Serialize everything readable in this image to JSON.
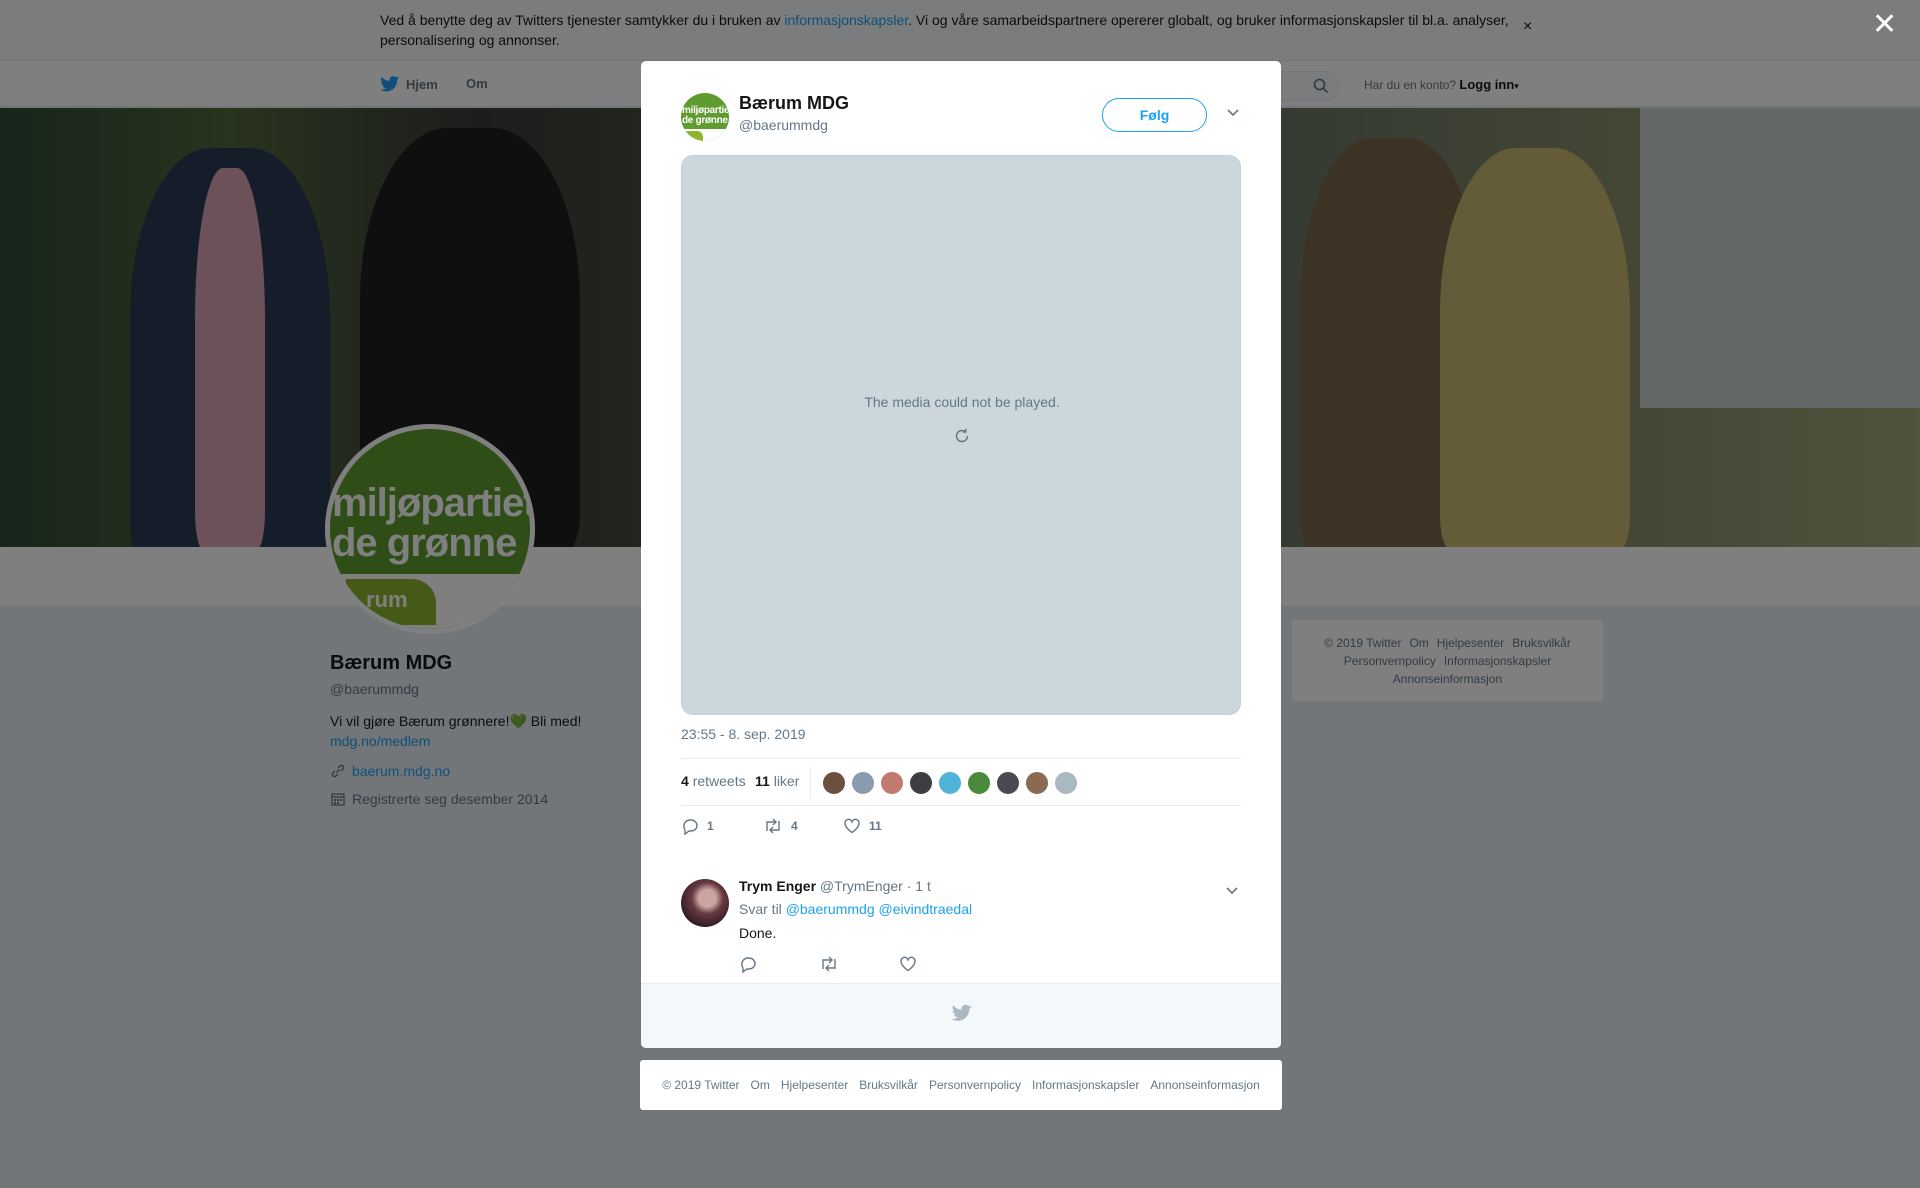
{
  "cookie": {
    "text_before": "Ved å benytte deg av Twitters tjenester samtykker du i bruken av ",
    "link": "informasjonskapsler",
    "text_after": ". Vi og våre samarbeidspartnere opererer globalt, og bruker informasjonskapsler til bl.a. analyser, personalisering og annonser.",
    "close_glyph": "×"
  },
  "nav": {
    "home": "Hjem",
    "about": "Om",
    "account_prompt": "Har du en konto?",
    "login": "Logg inn"
  },
  "profile": {
    "avatar_line1": "miljøpartiet",
    "avatar_line2": "de grønne",
    "avatar_badge": "rum",
    "name": "Bærum MDG",
    "handle": "@baerummdg",
    "bio_text": "Vi vil gjøre Bærum grønnere!",
    "bio_heart": "💚",
    "bio_after": " Bli med!",
    "bio_link": "mdg.no/medlem",
    "url": "baerum.mdg.no",
    "joined": "Registrerte seg desember 2014"
  },
  "side_footer": {
    "row1": [
      "© 2019 Twitter",
      "Om",
      "Hjelpesenter",
      "Bruksvilkår"
    ],
    "row2": [
      "Personvernpolicy",
      "Informasjonskapsler"
    ],
    "row3": [
      "Annonseinformasjon"
    ]
  },
  "overlay": {
    "close_glyph": "✕"
  },
  "tweet": {
    "avatar_line1": "miljøpartiet",
    "avatar_line2": "de grønne",
    "name": "Bærum MDG",
    "handle": "@baerummdg",
    "follow_label": "Følg",
    "media_message": "The media could not be played.",
    "timestamp": "23:55 - 8. sep. 2019",
    "retweets_count": "4",
    "retweets_label": "retweets",
    "likes_count": "11",
    "likes_label": "liker",
    "liker_colors": [
      "#6b5040",
      "#8a9ab0",
      "#c07a6e",
      "#3d3d44",
      "#4fb4d8",
      "#4a8a3a",
      "#4a4a52",
      "#8a6a50",
      "#aab8c2"
    ],
    "action_reply_count": "1",
    "action_retweet_count": "4",
    "action_like_count": "11"
  },
  "reply": {
    "name": "Trym Enger",
    "handle": "@TrymEnger",
    "time": "· 1 t",
    "reply_prefix": "Svar til",
    "mention1": "@baerummdg",
    "mention2": "@eivindtraedal",
    "text": "Done."
  },
  "bottom_footer": {
    "links": [
      "© 2019 Twitter",
      "Om",
      "Hjelpesenter",
      "Bruksvilkår",
      "Personvernpolicy",
      "Informasjonskapsler",
      "Annonseinformasjon"
    ]
  }
}
